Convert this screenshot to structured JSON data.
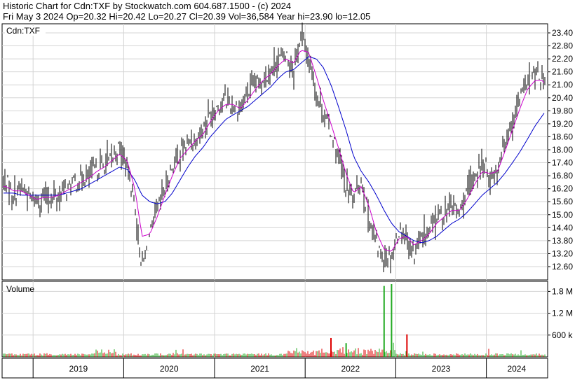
{
  "header": {
    "line1": "Historic Chart for Cdn:TXF by Stockwatch.com 604.687.1500 - (c) 2024",
    "line2": "Fri May  3 2024   Op=20.32   Hi=20.42   Lo=20.27   Cl=20.39   Vol=36,584   Year hi=23.90   lo=12.05"
  },
  "chart_data": {
    "type": "line",
    "symbol": "Cdn:TXF",
    "volume_label": "Volume",
    "price_axis": {
      "ticks": [
        "23.40",
        "22.80",
        "22.20",
        "21.60",
        "21.00",
        "20.40",
        "19.80",
        "19.20",
        "18.60",
        "18.00",
        "17.40",
        "16.80",
        "16.20",
        "15.60",
        "15.00",
        "14.40",
        "13.80",
        "13.20",
        "12.60"
      ],
      "range": [
        12.05,
        23.9
      ]
    },
    "volume_axis": {
      "ticks": [
        "1.8 M",
        "1.2 M",
        "600 k"
      ],
      "range": [
        0,
        2000000
      ]
    },
    "x_labels": [
      "2019",
      "2020",
      "2021",
      "2022",
      "2023",
      "2024"
    ],
    "colors": {
      "price": "#000000",
      "ma_short": "#cc00cc",
      "ma_long": "#0000cc",
      "vol_up": "#22aa22",
      "vol_down": "#dd0000",
      "grid": "#d4d4d4"
    },
    "price_series": [
      {
        "date": "2018-09",
        "v": 16.5
      },
      {
        "date": "2018-10",
        "v": 15.9
      },
      {
        "date": "2018-11",
        "v": 16.3
      },
      {
        "date": "2018-12",
        "v": 15.8
      },
      {
        "date": "2019-01",
        "v": 15.6
      },
      {
        "date": "2019-02",
        "v": 15.9
      },
      {
        "date": "2019-03",
        "v": 15.7
      },
      {
        "date": "2019-04",
        "v": 15.9
      },
      {
        "date": "2019-05",
        "v": 16.2
      },
      {
        "date": "2019-06",
        "v": 16.4
      },
      {
        "date": "2019-07",
        "v": 16.6
      },
      {
        "date": "2019-08",
        "v": 16.8
      },
      {
        "date": "2019-09",
        "v": 17.1
      },
      {
        "date": "2019-10",
        "v": 17.3
      },
      {
        "date": "2019-11",
        "v": 17.6
      },
      {
        "date": "2019-12",
        "v": 18.1
      },
      {
        "date": "2020-01",
        "v": 17.2
      },
      {
        "date": "2020-02",
        "v": 15.5
      },
      {
        "date": "2020-03",
        "v": 12.5
      },
      {
        "date": "2020-04",
        "v": 14.0
      },
      {
        "date": "2020-05",
        "v": 15.2
      },
      {
        "date": "2020-06",
        "v": 16.2
      },
      {
        "date": "2020-07",
        "v": 17.2
      },
      {
        "date": "2020-08",
        "v": 17.9
      },
      {
        "date": "2020-09",
        "v": 18.3
      },
      {
        "date": "2020-10",
        "v": 18.5
      },
      {
        "date": "2020-11",
        "v": 19.0
      },
      {
        "date": "2020-12",
        "v": 19.7
      },
      {
        "date": "2021-01",
        "v": 20.0
      },
      {
        "date": "2021-02",
        "v": 20.3
      },
      {
        "date": "2021-03",
        "v": 20.0
      },
      {
        "date": "2021-04",
        "v": 19.9
      },
      {
        "date": "2021-05",
        "v": 20.6
      },
      {
        "date": "2021-06",
        "v": 21.0
      },
      {
        "date": "2021-07",
        "v": 21.3
      },
      {
        "date": "2021-08",
        "v": 21.6
      },
      {
        "date": "2021-09",
        "v": 22.2
      },
      {
        "date": "2021-10",
        "v": 22.4
      },
      {
        "date": "2021-11",
        "v": 21.8
      },
      {
        "date": "2021-12",
        "v": 23.3
      },
      {
        "date": "2022-01",
        "v": 22.3
      },
      {
        "date": "2022-02",
        "v": 20.6
      },
      {
        "date": "2022-03",
        "v": 19.8
      },
      {
        "date": "2022-04",
        "v": 18.8
      },
      {
        "date": "2022-05",
        "v": 17.6
      },
      {
        "date": "2022-06",
        "v": 16.3
      },
      {
        "date": "2022-07",
        "v": 15.7
      },
      {
        "date": "2022-08",
        "v": 16.6
      },
      {
        "date": "2022-09",
        "v": 14.8
      },
      {
        "date": "2022-10",
        "v": 13.6
      },
      {
        "date": "2022-11",
        "v": 13.0
      },
      {
        "date": "2022-12",
        "v": 13.1
      },
      {
        "date": "2023-01",
        "v": 14.3
      },
      {
        "date": "2023-02",
        "v": 14.0
      },
      {
        "date": "2023-03",
        "v": 13.2
      },
      {
        "date": "2023-04",
        "v": 13.8
      },
      {
        "date": "2023-05",
        "v": 14.3
      },
      {
        "date": "2023-06",
        "v": 14.9
      },
      {
        "date": "2023-07",
        "v": 15.1
      },
      {
        "date": "2023-08",
        "v": 15.4
      },
      {
        "date": "2023-09",
        "v": 15.1
      },
      {
        "date": "2023-10",
        "v": 16.0
      },
      {
        "date": "2023-11",
        "v": 16.8
      },
      {
        "date": "2023-12",
        "v": 17.4
      },
      {
        "date": "2024-01",
        "v": 16.8
      },
      {
        "date": "2024-02",
        "v": 17.1
      },
      {
        "date": "2024-03",
        "v": 18.4
      },
      {
        "date": "2024-04",
        "v": 19.4
      },
      {
        "date": "2024-05",
        "v": 20.4
      },
      {
        "date": "2024-06",
        "v": 21.2
      },
      {
        "date": "2024-07",
        "v": 21.4
      },
      {
        "date": "2024-08",
        "v": 21.3
      },
      {
        "date": "2024-09",
        "v": 20.4
      }
    ],
    "ma_short_series": [
      {
        "date": "2018-09",
        "v": 16.3
      },
      {
        "date": "2018-10",
        "v": 16.1
      },
      {
        "date": "2018-11",
        "v": 16.1
      },
      {
        "date": "2018-12",
        "v": 15.9
      },
      {
        "date": "2019-01",
        "v": 15.7
      },
      {
        "date": "2019-02",
        "v": 15.8
      },
      {
        "date": "2019-03",
        "v": 15.8
      },
      {
        "date": "2019-04",
        "v": 15.9
      },
      {
        "date": "2019-05",
        "v": 16.1
      },
      {
        "date": "2019-06",
        "v": 16.3
      },
      {
        "date": "2019-07",
        "v": 16.5
      },
      {
        "date": "2019-08",
        "v": 16.7
      },
      {
        "date": "2019-09",
        "v": 17.0
      },
      {
        "date": "2019-10",
        "v": 17.2
      },
      {
        "date": "2019-11",
        "v": 17.5
      },
      {
        "date": "2019-12",
        "v": 17.8
      },
      {
        "date": "2020-01",
        "v": 17.5
      },
      {
        "date": "2020-02",
        "v": 16.2
      },
      {
        "date": "2020-03",
        "v": 14.0
      },
      {
        "date": "2020-04",
        "v": 14.1
      },
      {
        "date": "2020-05",
        "v": 14.9
      },
      {
        "date": "2020-06",
        "v": 15.9
      },
      {
        "date": "2020-07",
        "v": 16.8
      },
      {
        "date": "2020-08",
        "v": 17.6
      },
      {
        "date": "2020-09",
        "v": 18.0
      },
      {
        "date": "2020-10",
        "v": 18.4
      },
      {
        "date": "2020-11",
        "v": 18.7
      },
      {
        "date": "2020-12",
        "v": 19.3
      },
      {
        "date": "2021-01",
        "v": 19.8
      },
      {
        "date": "2021-02",
        "v": 20.1
      },
      {
        "date": "2021-03",
        "v": 20.1
      },
      {
        "date": "2021-04",
        "v": 19.9
      },
      {
        "date": "2021-05",
        "v": 20.3
      },
      {
        "date": "2021-06",
        "v": 20.8
      },
      {
        "date": "2021-07",
        "v": 21.2
      },
      {
        "date": "2021-08",
        "v": 21.5
      },
      {
        "date": "2021-09",
        "v": 21.9
      },
      {
        "date": "2021-10",
        "v": 22.2
      },
      {
        "date": "2021-11",
        "v": 22.0
      },
      {
        "date": "2021-12",
        "v": 22.6
      },
      {
        "date": "2022-01",
        "v": 22.5
      },
      {
        "date": "2022-02",
        "v": 21.4
      },
      {
        "date": "2022-03",
        "v": 20.3
      },
      {
        "date": "2022-04",
        "v": 19.2
      },
      {
        "date": "2022-05",
        "v": 18.1
      },
      {
        "date": "2022-06",
        "v": 16.9
      },
      {
        "date": "2022-07",
        "v": 16.0
      },
      {
        "date": "2022-08",
        "v": 16.3
      },
      {
        "date": "2022-09",
        "v": 15.4
      },
      {
        "date": "2022-10",
        "v": 14.2
      },
      {
        "date": "2022-11",
        "v": 13.4
      },
      {
        "date": "2022-12",
        "v": 13.3
      },
      {
        "date": "2023-01",
        "v": 13.9
      },
      {
        "date": "2023-02",
        "v": 14.0
      },
      {
        "date": "2023-03",
        "v": 13.6
      },
      {
        "date": "2023-04",
        "v": 13.8
      },
      {
        "date": "2023-05",
        "v": 14.1
      },
      {
        "date": "2023-06",
        "v": 14.6
      },
      {
        "date": "2023-07",
        "v": 14.9
      },
      {
        "date": "2023-08",
        "v": 15.2
      },
      {
        "date": "2023-09",
        "v": 15.2
      },
      {
        "date": "2023-10",
        "v": 15.7
      },
      {
        "date": "2023-11",
        "v": 16.4
      },
      {
        "date": "2023-12",
        "v": 17.0
      },
      {
        "date": "2024-01",
        "v": 16.9
      },
      {
        "date": "2024-02",
        "v": 17.0
      },
      {
        "date": "2024-03",
        "v": 17.9
      },
      {
        "date": "2024-04",
        "v": 18.9
      },
      {
        "date": "2024-05",
        "v": 19.9
      },
      {
        "date": "2024-06",
        "v": 20.8
      },
      {
        "date": "2024-07",
        "v": 21.2
      },
      {
        "date": "2024-08",
        "v": 21.2
      },
      {
        "date": "2024-09",
        "v": 20.6
      }
    ],
    "ma_long_series": [
      {
        "date": "2018-09",
        "v": 16.0
      },
      {
        "date": "2018-10",
        "v": 16.0
      },
      {
        "date": "2018-11",
        "v": 15.9
      },
      {
        "date": "2018-12",
        "v": 15.9
      },
      {
        "date": "2019-01",
        "v": 15.9
      },
      {
        "date": "2019-02",
        "v": 15.9
      },
      {
        "date": "2019-03",
        "v": 15.9
      },
      {
        "date": "2019-04",
        "v": 15.9
      },
      {
        "date": "2019-05",
        "v": 16.0
      },
      {
        "date": "2019-06",
        "v": 16.1
      },
      {
        "date": "2019-07",
        "v": 16.2
      },
      {
        "date": "2019-08",
        "v": 16.4
      },
      {
        "date": "2019-09",
        "v": 16.6
      },
      {
        "date": "2019-10",
        "v": 16.8
      },
      {
        "date": "2019-11",
        "v": 17.0
      },
      {
        "date": "2019-12",
        "v": 17.2
      },
      {
        "date": "2020-01",
        "v": 17.1
      },
      {
        "date": "2020-02",
        "v": 16.6
      },
      {
        "date": "2020-03",
        "v": 15.9
      },
      {
        "date": "2020-04",
        "v": 15.6
      },
      {
        "date": "2020-05",
        "v": 15.5
      },
      {
        "date": "2020-06",
        "v": 15.6
      },
      {
        "date": "2020-07",
        "v": 16.0
      },
      {
        "date": "2020-08",
        "v": 16.6
      },
      {
        "date": "2020-09",
        "v": 17.2
      },
      {
        "date": "2020-10",
        "v": 17.7
      },
      {
        "date": "2020-11",
        "v": 18.1
      },
      {
        "date": "2020-12",
        "v": 18.6
      },
      {
        "date": "2021-01",
        "v": 19.0
      },
      {
        "date": "2021-02",
        "v": 19.4
      },
      {
        "date": "2021-03",
        "v": 19.6
      },
      {
        "date": "2021-04",
        "v": 19.8
      },
      {
        "date": "2021-05",
        "v": 20.0
      },
      {
        "date": "2021-06",
        "v": 20.3
      },
      {
        "date": "2021-07",
        "v": 20.6
      },
      {
        "date": "2021-08",
        "v": 20.9
      },
      {
        "date": "2021-09",
        "v": 21.3
      },
      {
        "date": "2021-10",
        "v": 21.6
      },
      {
        "date": "2021-11",
        "v": 21.7
      },
      {
        "date": "2021-12",
        "v": 22.0
      },
      {
        "date": "2022-01",
        "v": 22.3
      },
      {
        "date": "2022-02",
        "v": 22.2
      },
      {
        "date": "2022-03",
        "v": 21.8
      },
      {
        "date": "2022-04",
        "v": 21.0
      },
      {
        "date": "2022-05",
        "v": 20.0
      },
      {
        "date": "2022-06",
        "v": 18.9
      },
      {
        "date": "2022-07",
        "v": 17.7
      },
      {
        "date": "2022-08",
        "v": 17.0
      },
      {
        "date": "2022-09",
        "v": 16.5
      },
      {
        "date": "2022-10",
        "v": 15.9
      },
      {
        "date": "2022-11",
        "v": 15.2
      },
      {
        "date": "2022-12",
        "v": 14.6
      },
      {
        "date": "2023-01",
        "v": 14.2
      },
      {
        "date": "2023-02",
        "v": 14.0
      },
      {
        "date": "2023-03",
        "v": 13.8
      },
      {
        "date": "2023-04",
        "v": 13.7
      },
      {
        "date": "2023-05",
        "v": 13.8
      },
      {
        "date": "2023-06",
        "v": 14.0
      },
      {
        "date": "2023-07",
        "v": 14.3
      },
      {
        "date": "2023-08",
        "v": 14.6
      },
      {
        "date": "2023-09",
        "v": 14.8
      },
      {
        "date": "2023-10",
        "v": 15.1
      },
      {
        "date": "2023-11",
        "v": 15.5
      },
      {
        "date": "2023-12",
        "v": 15.9
      },
      {
        "date": "2024-01",
        "v": 16.2
      },
      {
        "date": "2024-02",
        "v": 16.5
      },
      {
        "date": "2024-03",
        "v": 16.9
      },
      {
        "date": "2024-04",
        "v": 17.4
      },
      {
        "date": "2024-05",
        "v": 17.9
      },
      {
        "date": "2024-06",
        "v": 18.5
      },
      {
        "date": "2024-07",
        "v": 19.1
      },
      {
        "date": "2024-08",
        "v": 19.6
      },
      {
        "date": "2024-09",
        "v": 20.1
      }
    ],
    "volume_spikes": [
      {
        "date": "2022-04",
        "v": 520000,
        "dir": "down"
      },
      {
        "date": "2022-06",
        "v": 380000,
        "dir": "up"
      },
      {
        "date": "2022-11",
        "v": 1950000,
        "dir": "up"
      },
      {
        "date": "2022-12",
        "v": 2000000,
        "dir": "up"
      },
      {
        "date": "2023-02",
        "v": 620000,
        "dir": "down"
      }
    ]
  }
}
